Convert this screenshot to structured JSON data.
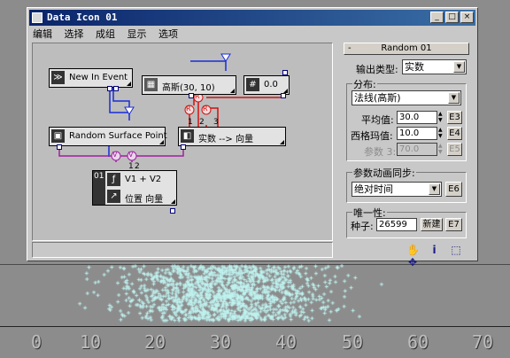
{
  "window": {
    "title": "Data Icon 01",
    "controls": [
      "_",
      "□",
      "×"
    ]
  },
  "menu": [
    "编辑",
    "选择",
    "成组",
    "显示",
    "选项"
  ],
  "nodes": {
    "new_in_event": {
      "label": "New In Event"
    },
    "gauss": {
      "label": "高斯(30, 10)"
    },
    "constant": {
      "label": "0.0"
    },
    "random_surface_point": {
      "label": "Random Surface Point"
    },
    "real_to_vector": {
      "label": "实数 --> 向量"
    },
    "expression": {
      "badge": "01",
      "line1": "V1 + V2",
      "line2": "位置 向量"
    }
  },
  "wire_badges": {
    "r": "R",
    "v": "V",
    "ports_real": [
      "1",
      "2",
      "3"
    ],
    "ports_v": [
      "1",
      "2"
    ]
  },
  "panel": {
    "rollout_title": "Random 01",
    "output_type_label": "输出类型:",
    "output_type_value": "实数",
    "distribution_group": "分布:",
    "distribution_value": "法线(高斯)",
    "mean_label": "平均值:",
    "mean_value": "30.0",
    "mean_button": "E3",
    "sigma_label": "西格玛值:",
    "sigma_value": "10.0",
    "sigma_button": "E4",
    "param3_label": "参数 3:",
    "param3_value": "70.0",
    "param3_button": "E5",
    "anim_group": "参数动画同步:",
    "anim_value": "绝对时间",
    "anim_button": "E6",
    "unique_group": "唯一性:",
    "seed_label": "种子:",
    "seed_value": "26599",
    "new_button": "新建",
    "unique_button": "E7"
  },
  "toolbar_icons": [
    "hand-pan-icon",
    "info-icon",
    "select-region-icon",
    "navigate-icon"
  ],
  "viewport": {
    "axis_ticks": [
      "0",
      "10",
      "20",
      "30",
      "40",
      "50",
      "60",
      "70"
    ]
  },
  "colors": {
    "title_start": "#0a246a",
    "title_end": "#3a6ea5",
    "wire_blue": "#1a2dd8",
    "wire_red": "#d01010",
    "wire_purple": "#a020a0",
    "particle": "#bff3f0"
  }
}
